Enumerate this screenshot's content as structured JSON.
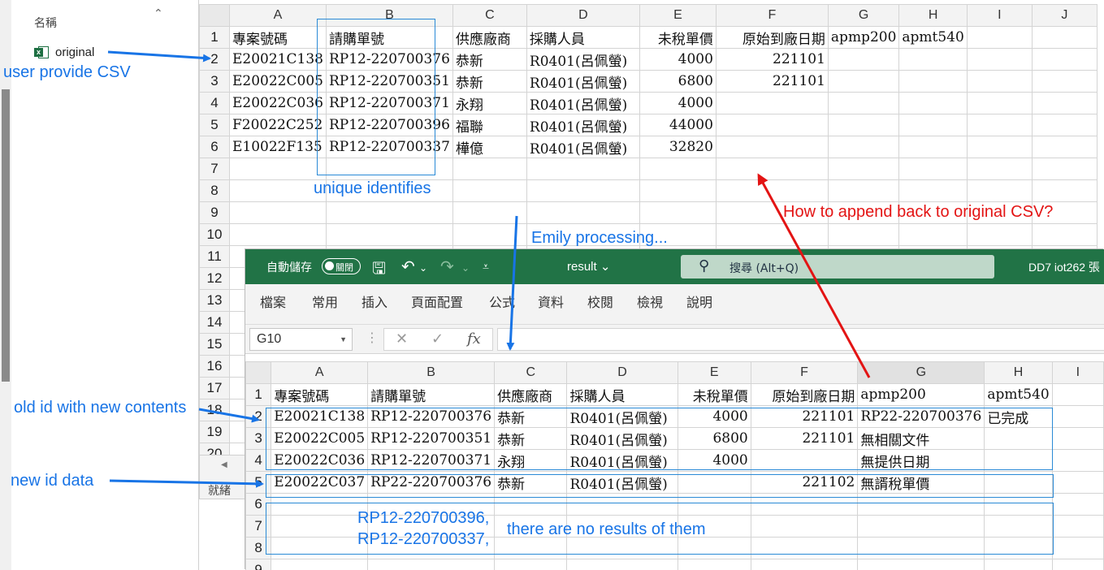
{
  "colors": {
    "excel_green": "#217346",
    "annotation_blue": "#1874e6",
    "annotation_red": "#e31414",
    "grid_line": "#d4d4d4"
  },
  "explorer": {
    "column_header": "名稱",
    "sort_icon": "chevron-up-icon",
    "file": {
      "icon": "excel-csv-file-icon",
      "name": "original"
    }
  },
  "sheet1": {
    "columns": [
      "A",
      "B",
      "C",
      "D",
      "E",
      "F",
      "G",
      "H",
      "I",
      "J"
    ],
    "rows": [
      [
        "專案號碼",
        "請購單號",
        "供應廠商",
        "採購人員",
        "未稅單價",
        "原始到廠日期",
        "apmp200",
        "apmt540",
        "",
        ""
      ],
      [
        "E20021C138",
        "RP12-220700376",
        "恭新",
        "R0401(呂佩螢)",
        "4000",
        "221101",
        "",
        "",
        "",
        ""
      ],
      [
        "E20022C005",
        "RP12-220700351",
        "恭新",
        "R0401(呂佩螢)",
        "6800",
        "221101",
        "",
        "",
        "",
        ""
      ],
      [
        "E20022C036",
        "RP12-220700371",
        "永翔",
        "R0401(呂佩螢)",
        "4000",
        "",
        "",
        "",
        "",
        ""
      ],
      [
        "F20022C252",
        "RP12-220700396",
        "福聯",
        "R0401(呂佩螢)",
        "44000",
        "",
        "",
        "",
        "",
        ""
      ],
      [
        "E10022F135",
        "RP12-220700337",
        "樺億",
        "R0401(呂佩螢)",
        "32820",
        "",
        "",
        "",
        "",
        ""
      ],
      [
        "",
        "",
        "",
        "",
        "",
        "",
        "",
        "",
        "",
        ""
      ],
      [
        "",
        "",
        "",
        "",
        "",
        "",
        "",
        "",
        "",
        ""
      ],
      [
        "",
        "",
        "",
        "",
        "",
        "",
        "",
        "",
        "",
        ""
      ],
      [
        "",
        "",
        "",
        "",
        "",
        "",
        "",
        "",
        "",
        ""
      ],
      [
        "",
        "",
        "",
        "",
        "",
        "",
        "",
        "",
        "",
        ""
      ],
      [
        "",
        "",
        "",
        "",
        "",
        "",
        "",
        "",
        "",
        ""
      ],
      [
        "",
        "",
        "",
        "",
        "",
        "",
        "",
        "",
        "",
        ""
      ],
      [
        "",
        "",
        "",
        "",
        "",
        "",
        "",
        "",
        "",
        ""
      ],
      [
        "",
        "",
        "",
        "",
        "",
        "",
        "",
        "",
        "",
        ""
      ],
      [
        "",
        "",
        "",
        "",
        "",
        "",
        "",
        "",
        "",
        ""
      ],
      [
        "",
        "",
        "",
        "",
        "",
        "",
        "",
        "",
        "",
        ""
      ],
      [
        "",
        "",
        "",
        "",
        "",
        "",
        "",
        "",
        "",
        ""
      ],
      [
        "",
        "",
        "",
        "",
        "",
        "",
        "",
        "",
        "",
        ""
      ],
      [
        "",
        "",
        "",
        "",
        "",
        "",
        "",
        "",
        "",
        ""
      ]
    ],
    "row_numbers": [
      "1",
      "2",
      "3",
      "4",
      "5",
      "6",
      "7",
      "8",
      "9",
      "10",
      "11",
      "12",
      "13",
      "14",
      "15",
      "16",
      "17",
      "18",
      "19",
      "20"
    ],
    "status_ready": "就緒"
  },
  "window2": {
    "autosave_label": "自動儲存",
    "autosave_toggle": "關閉",
    "doc_title": "result",
    "search_placeholder": "搜尋 (Alt+Q)",
    "user": "DD7 iot262 張",
    "ribbon_tabs": [
      "檔案",
      "常用",
      "插入",
      "頁面配置",
      "公式",
      "資料",
      "校閱",
      "檢視",
      "說明"
    ],
    "namebox": "G10",
    "fx_label": "fx",
    "columns": [
      "A",
      "B",
      "C",
      "D",
      "E",
      "F",
      "G",
      "H",
      "I"
    ],
    "row_numbers": [
      "1",
      "2",
      "3",
      "4",
      "5",
      "6",
      "7",
      "8",
      "9"
    ],
    "rows": [
      [
        "專案號碼",
        "請購單號",
        "供應廠商",
        "採購人員",
        "未稅單價",
        "原始到廠日期",
        "apmp200",
        "apmt540",
        ""
      ],
      [
        "E20021C138",
        "RP12-220700376",
        "恭新",
        "R0401(呂佩螢)",
        "4000",
        "221101",
        "RP22-220700376",
        "已完成",
        ""
      ],
      [
        "E20022C005",
        "RP12-220700351",
        "恭新",
        "R0401(呂佩螢)",
        "6800",
        "221101",
        "無相關文件",
        "",
        ""
      ],
      [
        "E20022C036",
        "RP12-220700371",
        "永翔",
        "R0401(呂佩螢)",
        "4000",
        "",
        "無提供日期",
        "",
        ""
      ],
      [
        "E20022C037",
        "RP22-220700376",
        "恭新",
        "R0401(呂佩螢)",
        "",
        "221102",
        "無諝稅單價",
        "",
        ""
      ],
      [
        "",
        "",
        "",
        "",
        "",
        "",
        "",
        "",
        ""
      ],
      [
        "",
        "",
        "",
        "",
        "",
        "",
        "",
        "",
        ""
      ],
      [
        "",
        "",
        "",
        "",
        "",
        "",
        "",
        "",
        ""
      ],
      [
        "",
        "",
        "",
        "",
        "",
        "",
        "",
        "",
        ""
      ]
    ]
  },
  "annotations": {
    "user_provide": "user provide CSV",
    "unique_identifies": "unique identifies",
    "emily_processing": "Emily processing...",
    "how_to_append": "How to append back to original CSV?",
    "old_id": "old id with new contents",
    "new_id": "new id data",
    "no_results_line1": "RP12-220700396,",
    "no_results_line2": "RP12-220700337,",
    "no_results_text": "there are no results of them"
  }
}
